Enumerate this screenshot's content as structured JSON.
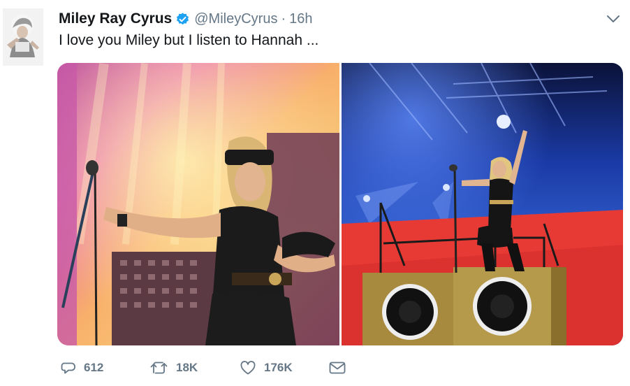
{
  "author": {
    "name": "Miley Ray Cyrus",
    "handle": "@MileyCyrus",
    "separator": "·",
    "time": "16h",
    "verified": true
  },
  "tweet": {
    "text": "I love you Miley but I listen to Hannah ..."
  },
  "media": {
    "count": 2
  },
  "actions": {
    "reply_count": "612",
    "retweet_count": "18K",
    "like_count": "176K"
  },
  "colors": {
    "text": "#14171a",
    "secondary": "#657786",
    "verified": "#1da1f2"
  },
  "icons": [
    "verified-icon",
    "chevron-down-icon",
    "reply-icon",
    "retweet-icon",
    "like-icon",
    "direct-message-icon"
  ]
}
